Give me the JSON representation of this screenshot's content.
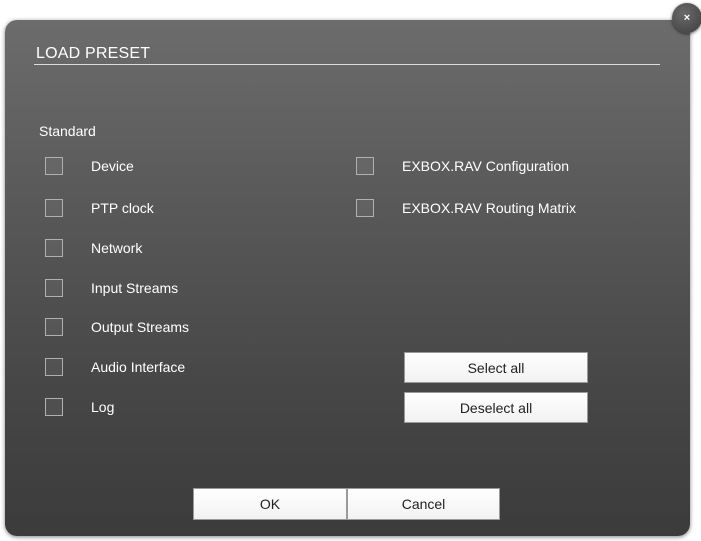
{
  "dialog": {
    "title": "LOAD PRESET",
    "close_glyph": "×",
    "section_label": "Standard",
    "options_left": [
      {
        "label": "Device",
        "checked": false
      },
      {
        "label": "PTP clock",
        "checked": false
      },
      {
        "label": "Network",
        "checked": false
      },
      {
        "label": "Input Streams",
        "checked": false
      },
      {
        "label": "Output Streams",
        "checked": false
      },
      {
        "label": "Audio Interface",
        "checked": false
      },
      {
        "label": "Log",
        "checked": false
      }
    ],
    "options_right": [
      {
        "label": "EXBOX.RAV Configuration",
        "checked": false
      },
      {
        "label": "EXBOX.RAV Routing Matrix",
        "checked": false
      }
    ],
    "select_all_label": "Select all",
    "deselect_all_label": "Deselect all",
    "ok_label": "OK",
    "cancel_label": "Cancel"
  },
  "colors": {
    "dialog_top": "#6c6c6c",
    "dialog_bottom": "#3b3b3b",
    "text": "#ffffff",
    "button_face": "#ffffff"
  }
}
